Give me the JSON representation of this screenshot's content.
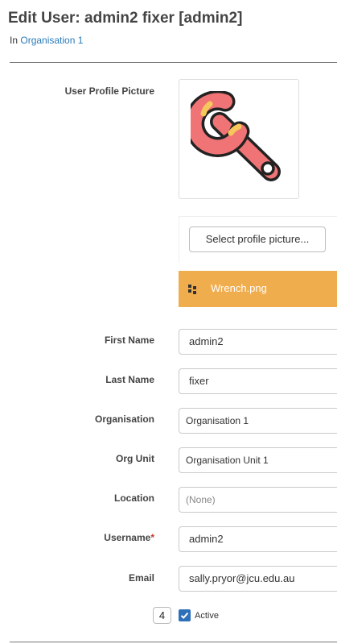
{
  "header": {
    "title": "Edit User: admin2 fixer [admin2]",
    "subtitle_prefix": "In",
    "organisation_link": "Organisation 1"
  },
  "profile_picture": {
    "label": "User Profile Picture",
    "icon": "wrench-icon",
    "select_button": "Select profile picture...",
    "file_name": "Wrench.png",
    "file_bar_color": "#f0ad4e"
  },
  "form": {
    "first_name": {
      "label": "First Name",
      "value": "admin2"
    },
    "last_name": {
      "label": "Last Name",
      "value": "fixer"
    },
    "organisation": {
      "label": "Organisation",
      "value": "Organisation 1"
    },
    "org_unit": {
      "label": "Org Unit",
      "value": "Organisation Unit 1"
    },
    "location": {
      "label": "Location",
      "value": "(None)"
    },
    "username": {
      "label": "Username",
      "required_marker": "*",
      "value": "admin2"
    },
    "email": {
      "label": "Email",
      "value": "sally.pryor@jcu.edu.au"
    },
    "active": {
      "badge": "4",
      "label": "Active",
      "checked": true
    }
  },
  "colors": {
    "link": "#2a7ab8",
    "checkbox": "#2d6fb8",
    "required": "#c0392b"
  }
}
